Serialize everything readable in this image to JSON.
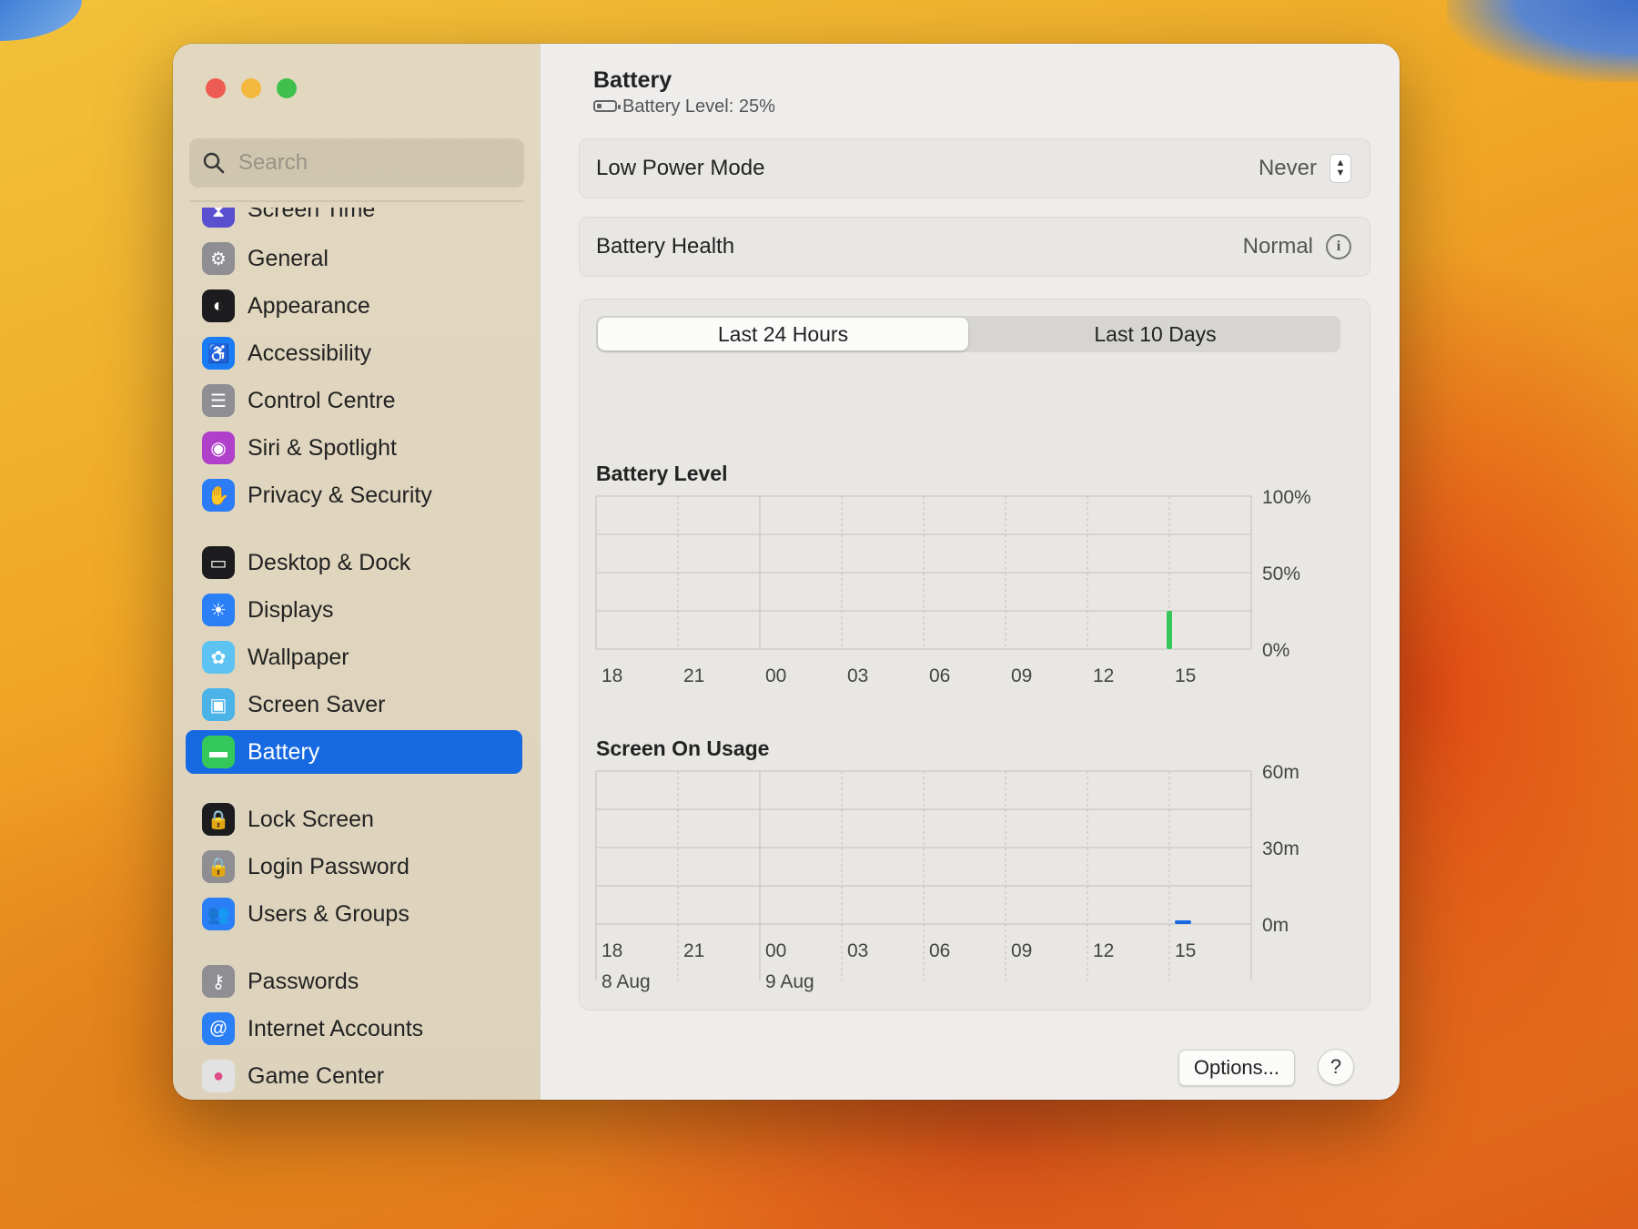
{
  "search": {
    "placeholder": "Search"
  },
  "sidebar": {
    "partial_item": "Screen Time",
    "items": [
      {
        "label": "General",
        "icon": "gear-icon",
        "color": "#8e8e93"
      },
      {
        "label": "Appearance",
        "icon": "appearance-icon",
        "color": "#1c1c1e"
      },
      {
        "label": "Accessibility",
        "icon": "accessibility-icon",
        "color": "#1a7cf5"
      },
      {
        "label": "Control Centre",
        "icon": "control-centre-icon",
        "color": "#8e8e93"
      },
      {
        "label": "Siri & Spotlight",
        "icon": "siri-icon",
        "color": "#b03fc9"
      },
      {
        "label": "Privacy & Security",
        "icon": "hand-icon",
        "color": "#2b7cf6"
      },
      {
        "label": "Desktop & Dock",
        "icon": "dock-icon",
        "color": "#1c1c1e"
      },
      {
        "label": "Displays",
        "icon": "sun-icon",
        "color": "#2a7ef6"
      },
      {
        "label": "Wallpaper",
        "icon": "flower-icon",
        "color": "#5cc3f3"
      },
      {
        "label": "Screen Saver",
        "icon": "screen-saver-icon",
        "color": "#4bb3e8"
      },
      {
        "label": "Battery",
        "icon": "battery-icon",
        "color": "#34c759",
        "active": true
      },
      {
        "label": "Lock Screen",
        "icon": "lock-screen-icon",
        "color": "#1c1c1e"
      },
      {
        "label": "Login Password",
        "icon": "lock-icon",
        "color": "#8e8e93"
      },
      {
        "label": "Users & Groups",
        "icon": "users-icon",
        "color": "#2a7ef6"
      },
      {
        "label": "Passwords",
        "icon": "key-icon",
        "color": "#8e8e93"
      },
      {
        "label": "Internet Accounts",
        "icon": "at-icon",
        "color": "#2a7ef6"
      },
      {
        "label": "Game Center",
        "icon": "game-center-icon",
        "color": "#e2e2e2"
      }
    ]
  },
  "header": {
    "title": "Battery",
    "subtitle": "Battery Level: 25%",
    "battery_level_fraction": 0.25
  },
  "low_power": {
    "label": "Low Power Mode",
    "value": "Never"
  },
  "health": {
    "label": "Battery Health",
    "value": "Normal"
  },
  "tabs": [
    {
      "label": "Last 24 Hours",
      "selected": true
    },
    {
      "label": "Last 10 Days",
      "selected": false
    }
  ],
  "chart_data": [
    {
      "type": "bar",
      "title": "Battery Level",
      "x": [
        "18",
        "21",
        "00",
        "03",
        "06",
        "09",
        "12",
        "15"
      ],
      "y_ticks": [
        "100%",
        "50%",
        "0%"
      ],
      "ylim": [
        0,
        100
      ],
      "bars": [
        {
          "x_hour_offset": 21.0,
          "value": 25,
          "color": "#34c759"
        }
      ],
      "grid": true
    },
    {
      "type": "bar",
      "title": "Screen On Usage",
      "x": [
        "18",
        "21",
        "00",
        "03",
        "06",
        "09",
        "12",
        "15"
      ],
      "date_labels": [
        {
          "label": "8 Aug",
          "tick": "18"
        },
        {
          "label": "9 Aug",
          "tick": "00"
        }
      ],
      "y_ticks": [
        "60m",
        "30m",
        "0m"
      ],
      "ylim": [
        0,
        60
      ],
      "bars": [
        {
          "x_hour_offset": 21.3,
          "value": 1,
          "color": "#1769e1"
        }
      ],
      "grid": true
    }
  ],
  "footer": {
    "options_label": "Options...",
    "help_label": "?"
  }
}
